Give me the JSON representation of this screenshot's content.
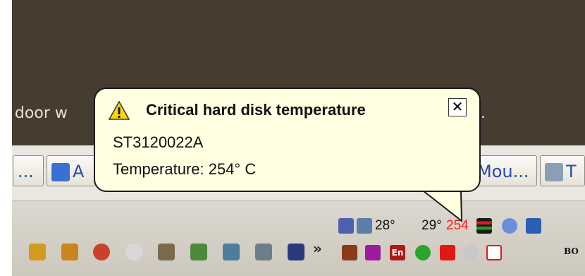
{
  "background_text": {
    "left_fragment": "n door w",
    "right_fragment": "."
  },
  "taskbar": {
    "buttons": [
      {
        "label": "..."
      },
      {
        "label": "A"
      },
      {
        "label": "Mou..."
      },
      {
        "label": "T"
      }
    ]
  },
  "balloon": {
    "title": "Critical hard disk temperature",
    "close_label": "✕",
    "device": "ST3120022A",
    "temperature_line": "Temperature: 254° C"
  },
  "tray": {
    "temp1": "28°",
    "temp2": "29°",
    "temp_critical": "254",
    "clock_fragment": "BO",
    "colors": {
      "critical": "#ff1a1a",
      "accent_green": "#2aa52a"
    }
  },
  "quick_launch": {
    "overflow_label": "»"
  }
}
